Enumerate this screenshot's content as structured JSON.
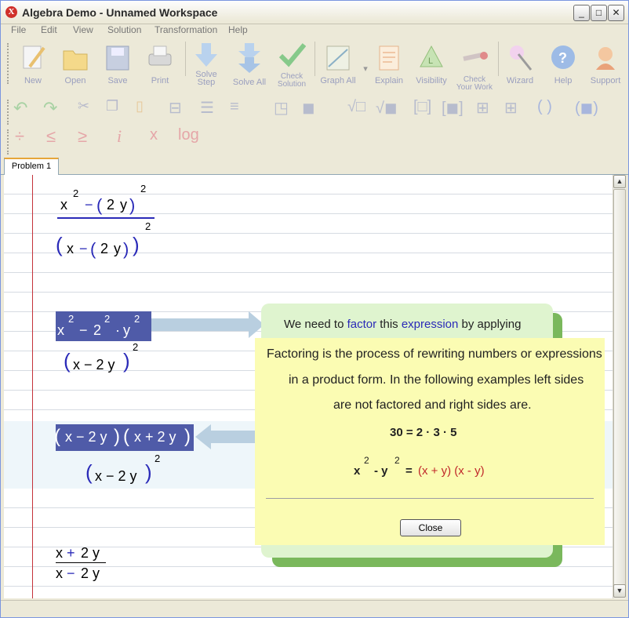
{
  "window": {
    "title": "Algebra Demo - Unnamed Workspace",
    "app_icon": "app-logo-icon",
    "controls": [
      "minimize-icon",
      "maximize-icon",
      "close-icon"
    ]
  },
  "menu": [
    "File",
    "Edit",
    "View",
    "Solution",
    "Transformation",
    "Help"
  ],
  "toolbar": {
    "buttons": [
      {
        "label": "New",
        "icon": "new-document-icon"
      },
      {
        "label": "Open",
        "icon": "folder-icon"
      },
      {
        "label": "Save",
        "icon": "floppy-disk-icon"
      },
      {
        "label": "Print",
        "icon": "printer-icon"
      },
      {
        "label": "Solve Step",
        "label1": "Solve",
        "label2": "Step",
        "icon": "down-arrow-icon"
      },
      {
        "label": "Solve All",
        "icon": "double-down-arrow-icon"
      },
      {
        "label": "Check Solution",
        "label1": "Check",
        "label2": "Solution",
        "icon": "checkmark-icon"
      },
      {
        "label": "Graph All",
        "icon": "graph-icon"
      },
      {
        "label": "Explain",
        "icon": "explain-icon"
      },
      {
        "label": "Visibility",
        "icon": "visibility-icon"
      },
      {
        "label": "Check Your Work",
        "label1": "Check",
        "label2": "Your Work",
        "icon": "check-work-icon"
      },
      {
        "label": "Wizard",
        "icon": "wizard-wand-icon"
      },
      {
        "label": "Help",
        "icon": "help-icon"
      },
      {
        "label": "Support",
        "icon": "support-icon"
      }
    ],
    "row3": {
      "divide": "÷",
      "le": "≤",
      "ge": "≥",
      "imag": "i",
      "sub": "x",
      "log": "log"
    }
  },
  "tabs": [
    {
      "label": "Problem 1",
      "active": true
    }
  ],
  "worksheet": {
    "step1": {
      "x": "x",
      "exp": "2",
      "minus": "−",
      "lp": "(",
      "two": "2",
      "y": "y",
      "rp": ")",
      "den_x": "x",
      "den_minus": "−",
      "den_two": "2",
      "den_y": "y"
    },
    "step2": {
      "x": "x",
      "exp": "2",
      "minus": "−",
      "two": "2",
      "exp2": "2",
      "dot": "·",
      "y": "y",
      "exp3": "2",
      "den": "x − 2 y",
      "den_exp": "2"
    },
    "step3": {
      "num1": "x − 2 y",
      "num2": "x + 2 y",
      "den": "x − 2 y",
      "den_exp": "2"
    },
    "step4": {
      "num_x": "x",
      "num_plus": "+",
      "num_rest": "2 y",
      "den_x": "x",
      "den_minus": "−",
      "den_rest": "2 y"
    }
  },
  "explain_popup": {
    "lead_text_1": "We need to ",
    "lead_link_1": "factor",
    "lead_text_2": " this ",
    "lead_link_2": "expression",
    "lead_text_3": " by applying",
    "line1": "Factoring is the process of rewriting numbers or expressions",
    "line2": "in a product form. In the following examples left sides",
    "line3": "are not factored and right sides are.",
    "example1": "30 = 2  · 3  · 5",
    "example2_left": "x",
    "example2_exp": "2",
    "example2_mid": "- y",
    "example2_exp2": "2",
    "example2_eq": "=",
    "example2_right": "(x + y)  (x - y)",
    "close_label": "Close"
  },
  "colors": {
    "accent": "#2a2ab8",
    "highlight": "#4f5ba8",
    "margin": "#c4323a",
    "popup_green": "#dff4cf",
    "popup_yellow": "#fbfcb3"
  }
}
